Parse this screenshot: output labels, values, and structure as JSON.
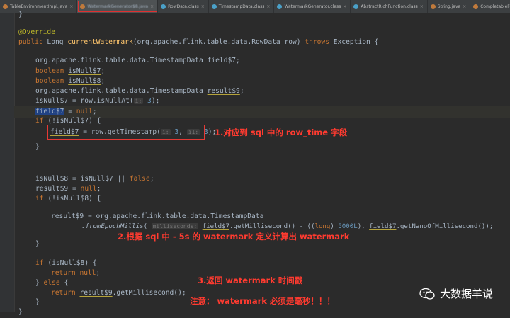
{
  "tabs": [
    {
      "label": "TableEnvironmentImpl.java",
      "color": "#c07a3c"
    },
    {
      "label": "WatermarkGenerator$8.java",
      "color": "#c07a3c",
      "active": true
    },
    {
      "label": "RowData.class",
      "color": "#4aa0c8"
    },
    {
      "label": "TimestampData.class",
      "color": "#4aa0c8"
    },
    {
      "label": "WatermarkGenerator.class",
      "color": "#4aa0c8"
    },
    {
      "label": "AbstractRichFunction.class",
      "color": "#4aa0c8"
    },
    {
      "label": "String.java",
      "color": "#c07a3c"
    },
    {
      "label": "CompletableFut",
      "color": "#c07a3c"
    }
  ],
  "code": {
    "brace_close_top": "}",
    "annotation": "@Override",
    "signature": {
      "public": "public",
      "ret_type": " Long ",
      "method": "currentWatermark",
      "params": "(org.apache.flink.table.data.RowData row) ",
      "throws": "throws",
      "exception": " Exception {"
    },
    "decl1_type": "org.apache.flink.table.data.TimestampData ",
    "decl1_var": "field$7",
    "boolean_kw": "boolean",
    "decl2_var": "isNull$7",
    "decl3_var": "isNull$8",
    "decl4_type": "org.apache.flink.table.data.TimestampData ",
    "decl4_var": "result$9",
    "isnull_assign": "isNull$7 = row.isNullAt(",
    "hint_i": "i:",
    "num_3": "3",
    "paren_close": ");",
    "field_sel": "field$7",
    "eq_null": " = ",
    "null_kw": "null",
    "if_kw": "if",
    "if_cond7": " (!isNull$7) {",
    "field_assign": "field$7",
    "get_ts": " = row.getTimestamp(",
    "hint_pos": "i:",
    "hint_prec": "i1:",
    "close_brace": "}",
    "isnull8_assign": "isNull$8 = isNull$7 || ",
    "false_kw": "false",
    "result_assign": "result$9 = ",
    "if_cond8": " (!isNull$8) {",
    "res_line1": "result$9 = org.apache.flink.table.data.TimestampData",
    "from_epoch": ".fromEpochMillis",
    "paren_open": "(",
    "hint_ms": "milliseconds:",
    "get_ms": ".getMillisecond() - ((",
    "long_kw": "long",
    "num_5000": "5000L",
    "get_nano": ".getNanoOfMillisecond());",
    "return_kw": "return",
    "else_kw": " else ",
    "return_ms": ".getMillisecond();",
    "res_var": "result$9"
  },
  "annotations": {
    "note1": "1.对应到 sql 中的 row_time 字段",
    "note2": "2.根据 sql 中 - 5s 的 watermark 定义计算出 watermark",
    "note3": "3.返回 watermark 时间戳",
    "note4": "注意：  watermark 必须是毫秒！！！"
  },
  "brand": {
    "name": "大数据羊说"
  }
}
